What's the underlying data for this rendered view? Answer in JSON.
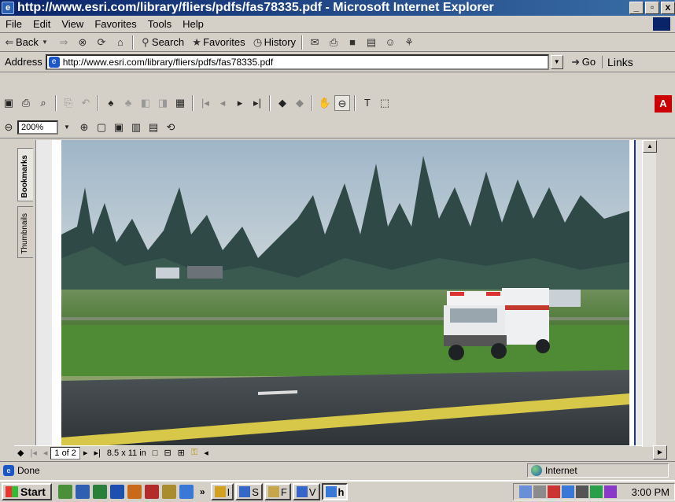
{
  "window": {
    "title": "http://www.esri.com/library/fliers/pdfs/fas78335.pdf - Microsoft Internet Explorer",
    "min": "_",
    "max": " ",
    "close": "x"
  },
  "menu": {
    "items": [
      {
        "label": "File",
        "key": "F"
      },
      {
        "label": "Edit",
        "key": "E"
      },
      {
        "label": "View",
        "key": "V"
      },
      {
        "label": "Favorites",
        "key": "a"
      },
      {
        "label": "Tools",
        "key": "T"
      },
      {
        "label": "Help",
        "key": "H"
      }
    ]
  },
  "toolbar": {
    "back": "Back",
    "search": "Search",
    "favorites": "Favorites",
    "history": "History"
  },
  "address": {
    "label": "Address",
    "url": "http://www.esri.com/library/fliers/pdfs/fas78335.pdf",
    "go": "Go",
    "links": "Links"
  },
  "pdf": {
    "zoom": "200%",
    "tabs": {
      "bookmarks": "Bookmarks",
      "thumbnails": "Thumbnails"
    },
    "page_indicator": "1 of 2",
    "page_size": "8.5 x 11 in"
  },
  "status": {
    "left": "Done",
    "zone": "Internet"
  },
  "taskbar": {
    "start": "Start",
    "more": "»",
    "buttons": [
      "I",
      "S",
      "F",
      "V",
      "h"
    ],
    "clock": "3:00 PM"
  }
}
